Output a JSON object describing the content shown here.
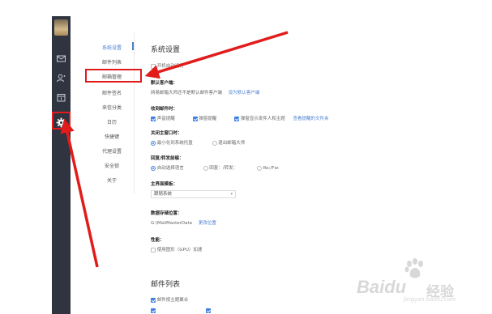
{
  "sidebar_rail": {
    "icons": [
      "avatar",
      "mail-icon",
      "contacts-icon",
      "calendar-icon",
      "gear-icon"
    ],
    "highlight_color": "#e21b1b"
  },
  "settings_nav": {
    "items": [
      {
        "label": "系统设置",
        "active": true
      },
      {
        "label": "邮件列表"
      },
      {
        "label": "邮箱管理"
      },
      {
        "label": "邮件签名"
      },
      {
        "label": "来信分类"
      },
      {
        "label": "日历"
      },
      {
        "label": "快捷键"
      },
      {
        "label": "代理设置"
      },
      {
        "label": "安全锁"
      },
      {
        "label": "关于"
      }
    ],
    "accent_color": "#4a7fd0"
  },
  "system_settings": {
    "title": "系统设置",
    "autostart_label": "开机自动运行",
    "default_client": {
      "heading": "默认客户端：",
      "text": "网易邮箱大师还不是默认邮件客户端",
      "link": "设为默认客户端"
    },
    "new_mail": {
      "heading": "收到邮件时：",
      "options": [
        "声音提醒",
        "弹窗提醒",
        "弹窗显示发件人和主题"
      ],
      "link": "查看提醒的文件夹"
    },
    "close_main": {
      "heading": "关闭主窗口时：",
      "options": [
        "最小化到系统托盘",
        "退出邮箱大师"
      ]
    },
    "reply_forward": {
      "heading": "回复/转发前缀：",
      "options": [
        "自动选择语言",
        "回复：/转发：",
        "Re:/Fw:"
      ]
    },
    "theme": {
      "heading": "主界面模板：",
      "value": "跟随系统"
    },
    "storage": {
      "heading": "数据存储位置：",
      "path": "G:\\MailMasterData",
      "link": "更改位置"
    },
    "performance": {
      "heading": "性能：",
      "option": "使用图形（GPU）加速"
    }
  },
  "mail_list": {
    "title": "邮件列表",
    "options": [
      "邮件按主题聚合"
    ]
  },
  "watermark": {
    "logo_text": "Baidu",
    "cn_text": "经验",
    "url": "jingyan.baidu.com"
  }
}
